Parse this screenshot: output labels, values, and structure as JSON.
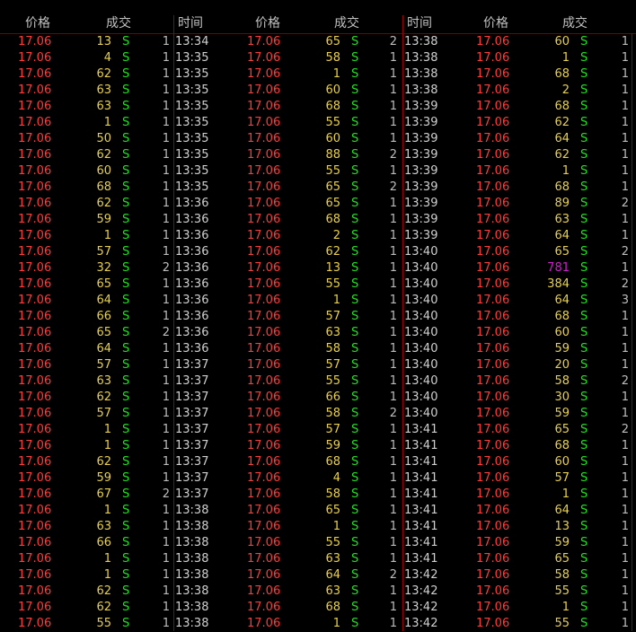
{
  "headers": {
    "panel1": [
      "价格",
      "成交"
    ],
    "panel2": [
      "时间",
      "价格",
      "成交"
    ],
    "panel3": [
      "时间",
      "价格",
      "成交"
    ]
  },
  "panels": [
    {
      "rows": [
        {
          "time": "",
          "price": "17.06",
          "volume": "13",
          "side": "S",
          "count": "1"
        },
        {
          "time": "",
          "price": "17.06",
          "volume": "4",
          "side": "S",
          "count": "1"
        },
        {
          "time": "",
          "price": "17.06",
          "volume": "62",
          "side": "S",
          "count": "1"
        },
        {
          "time": "",
          "price": "17.06",
          "volume": "63",
          "side": "S",
          "count": "1"
        },
        {
          "time": "",
          "price": "17.06",
          "volume": "63",
          "side": "S",
          "count": "1"
        },
        {
          "time": "",
          "price": "17.06",
          "volume": "1",
          "side": "S",
          "count": "1"
        },
        {
          "time": "",
          "price": "17.06",
          "volume": "50",
          "side": "S",
          "count": "1"
        },
        {
          "time": "",
          "price": "17.06",
          "volume": "62",
          "side": "S",
          "count": "1"
        },
        {
          "time": "",
          "price": "17.06",
          "volume": "60",
          "side": "S",
          "count": "1"
        },
        {
          "time": "",
          "price": "17.06",
          "volume": "68",
          "side": "S",
          "count": "1"
        },
        {
          "time": "",
          "price": "17.06",
          "volume": "62",
          "side": "S",
          "count": "1"
        },
        {
          "time": "",
          "price": "17.06",
          "volume": "59",
          "side": "S",
          "count": "1"
        },
        {
          "time": "",
          "price": "17.06",
          "volume": "1",
          "side": "S",
          "count": "1"
        },
        {
          "time": "",
          "price": "17.06",
          "volume": "57",
          "side": "S",
          "count": "1"
        },
        {
          "time": "",
          "price": "17.06",
          "volume": "32",
          "side": "S",
          "count": "2"
        },
        {
          "time": "",
          "price": "17.06",
          "volume": "65",
          "side": "S",
          "count": "1"
        },
        {
          "time": "",
          "price": "17.06",
          "volume": "64",
          "side": "S",
          "count": "1"
        },
        {
          "time": "",
          "price": "17.06",
          "volume": "66",
          "side": "S",
          "count": "1"
        },
        {
          "time": "",
          "price": "17.06",
          "volume": "65",
          "side": "S",
          "count": "2"
        },
        {
          "time": "",
          "price": "17.06",
          "volume": "64",
          "side": "S",
          "count": "1"
        },
        {
          "time": "",
          "price": "17.06",
          "volume": "57",
          "side": "S",
          "count": "1"
        },
        {
          "time": "",
          "price": "17.06",
          "volume": "63",
          "side": "S",
          "count": "1"
        },
        {
          "time": "",
          "price": "17.06",
          "volume": "62",
          "side": "S",
          "count": "1"
        },
        {
          "time": "",
          "price": "17.06",
          "volume": "57",
          "side": "S",
          "count": "1"
        },
        {
          "time": "",
          "price": "17.06",
          "volume": "1",
          "side": "S",
          "count": "1"
        },
        {
          "time": "",
          "price": "17.06",
          "volume": "1",
          "side": "S",
          "count": "1"
        },
        {
          "time": "",
          "price": "17.06",
          "volume": "62",
          "side": "S",
          "count": "1"
        },
        {
          "time": "",
          "price": "17.06",
          "volume": "59",
          "side": "S",
          "count": "1"
        },
        {
          "time": "",
          "price": "17.06",
          "volume": "67",
          "side": "S",
          "count": "2"
        },
        {
          "time": "",
          "price": "17.06",
          "volume": "1",
          "side": "S",
          "count": "1"
        },
        {
          "time": "",
          "price": "17.06",
          "volume": "63",
          "side": "S",
          "count": "1"
        },
        {
          "time": "",
          "price": "17.06",
          "volume": "66",
          "side": "S",
          "count": "1"
        },
        {
          "time": "",
          "price": "17.06",
          "volume": "1",
          "side": "S",
          "count": "1"
        },
        {
          "time": "",
          "price": "17.06",
          "volume": "1",
          "side": "S",
          "count": "1"
        },
        {
          "time": "",
          "price": "17.06",
          "volume": "62",
          "side": "S",
          "count": "1"
        },
        {
          "time": "",
          "price": "17.06",
          "volume": "62",
          "side": "S",
          "count": "1"
        },
        {
          "time": "",
          "price": "17.06",
          "volume": "55",
          "side": "S",
          "count": "1"
        }
      ]
    },
    {
      "rows": [
        {
          "time": "13:34",
          "price": "17.06",
          "volume": "65",
          "side": "S",
          "count": "2"
        },
        {
          "time": "13:35",
          "price": "17.06",
          "volume": "58",
          "side": "S",
          "count": "1"
        },
        {
          "time": "13:35",
          "price": "17.06",
          "volume": "1",
          "side": "S",
          "count": "1"
        },
        {
          "time": "13:35",
          "price": "17.06",
          "volume": "60",
          "side": "S",
          "count": "1"
        },
        {
          "time": "13:35",
          "price": "17.06",
          "volume": "68",
          "side": "S",
          "count": "1"
        },
        {
          "time": "13:35",
          "price": "17.06",
          "volume": "55",
          "side": "S",
          "count": "1"
        },
        {
          "time": "13:35",
          "price": "17.06",
          "volume": "60",
          "side": "S",
          "count": "1"
        },
        {
          "time": "13:35",
          "price": "17.06",
          "volume": "88",
          "side": "S",
          "count": "2"
        },
        {
          "time": "13:35",
          "price": "17.06",
          "volume": "55",
          "side": "S",
          "count": "1"
        },
        {
          "time": "13:35",
          "price": "17.06",
          "volume": "65",
          "side": "S",
          "count": "2"
        },
        {
          "time": "13:36",
          "price": "17.06",
          "volume": "65",
          "side": "S",
          "count": "1"
        },
        {
          "time": "13:36",
          "price": "17.06",
          "volume": "68",
          "side": "S",
          "count": "1"
        },
        {
          "time": "13:36",
          "price": "17.06",
          "volume": "2",
          "side": "S",
          "count": "1"
        },
        {
          "time": "13:36",
          "price": "17.06",
          "volume": "62",
          "side": "S",
          "count": "1"
        },
        {
          "time": "13:36",
          "price": "17.06",
          "volume": "13",
          "side": "S",
          "count": "1"
        },
        {
          "time": "13:36",
          "price": "17.06",
          "volume": "55",
          "side": "S",
          "count": "1"
        },
        {
          "time": "13:36",
          "price": "17.06",
          "volume": "1",
          "side": "S",
          "count": "1"
        },
        {
          "time": "13:36",
          "price": "17.06",
          "volume": "57",
          "side": "S",
          "count": "1"
        },
        {
          "time": "13:36",
          "price": "17.06",
          "volume": "63",
          "side": "S",
          "count": "1"
        },
        {
          "time": "13:36",
          "price": "17.06",
          "volume": "58",
          "side": "S",
          "count": "1"
        },
        {
          "time": "13:37",
          "price": "17.06",
          "volume": "57",
          "side": "S",
          "count": "1"
        },
        {
          "time": "13:37",
          "price": "17.06",
          "volume": "55",
          "side": "S",
          "count": "1"
        },
        {
          "time": "13:37",
          "price": "17.06",
          "volume": "66",
          "side": "S",
          "count": "1"
        },
        {
          "time": "13:37",
          "price": "17.06",
          "volume": "58",
          "side": "S",
          "count": "2"
        },
        {
          "time": "13:37",
          "price": "17.06",
          "volume": "57",
          "side": "S",
          "count": "1"
        },
        {
          "time": "13:37",
          "price": "17.06",
          "volume": "59",
          "side": "S",
          "count": "1"
        },
        {
          "time": "13:37",
          "price": "17.06",
          "volume": "68",
          "side": "S",
          "count": "1"
        },
        {
          "time": "13:37",
          "price": "17.06",
          "volume": "4",
          "side": "S",
          "count": "1"
        },
        {
          "time": "13:37",
          "price": "17.06",
          "volume": "58",
          "side": "S",
          "count": "1"
        },
        {
          "time": "13:38",
          "price": "17.06",
          "volume": "65",
          "side": "S",
          "count": "1"
        },
        {
          "time": "13:38",
          "price": "17.06",
          "volume": "1",
          "side": "S",
          "count": "1"
        },
        {
          "time": "13:38",
          "price": "17.06",
          "volume": "55",
          "side": "S",
          "count": "1"
        },
        {
          "time": "13:38",
          "price": "17.06",
          "volume": "63",
          "side": "S",
          "count": "1"
        },
        {
          "time": "13:38",
          "price": "17.06",
          "volume": "64",
          "side": "S",
          "count": "2"
        },
        {
          "time": "13:38",
          "price": "17.06",
          "volume": "63",
          "side": "S",
          "count": "1"
        },
        {
          "time": "13:38",
          "price": "17.06",
          "volume": "68",
          "side": "S",
          "count": "1"
        },
        {
          "time": "13:38",
          "price": "17.06",
          "volume": "1",
          "side": "S",
          "count": "1"
        }
      ]
    },
    {
      "rows": [
        {
          "time": "13:38",
          "price": "17.06",
          "volume": "60",
          "side": "S",
          "count": "1"
        },
        {
          "time": "13:38",
          "price": "17.06",
          "volume": "1",
          "side": "S",
          "count": "1"
        },
        {
          "time": "13:38",
          "price": "17.06",
          "volume": "68",
          "side": "S",
          "count": "1"
        },
        {
          "time": "13:38",
          "price": "17.06",
          "volume": "2",
          "side": "S",
          "count": "1"
        },
        {
          "time": "13:39",
          "price": "17.06",
          "volume": "68",
          "side": "S",
          "count": "1"
        },
        {
          "time": "13:39",
          "price": "17.06",
          "volume": "62",
          "side": "S",
          "count": "1"
        },
        {
          "time": "13:39",
          "price": "17.06",
          "volume": "64",
          "side": "S",
          "count": "1"
        },
        {
          "time": "13:39",
          "price": "17.06",
          "volume": "62",
          "side": "S",
          "count": "1"
        },
        {
          "time": "13:39",
          "price": "17.06",
          "volume": "1",
          "side": "S",
          "count": "1"
        },
        {
          "time": "13:39",
          "price": "17.06",
          "volume": "68",
          "side": "S",
          "count": "1"
        },
        {
          "time": "13:39",
          "price": "17.06",
          "volume": "89",
          "side": "S",
          "count": "2"
        },
        {
          "time": "13:39",
          "price": "17.06",
          "volume": "63",
          "side": "S",
          "count": "1"
        },
        {
          "time": "13:39",
          "price": "17.06",
          "volume": "64",
          "side": "S",
          "count": "1"
        },
        {
          "time": "13:40",
          "price": "17.06",
          "volume": "65",
          "side": "S",
          "count": "2"
        },
        {
          "time": "13:40",
          "price": "17.06",
          "volume": "781",
          "side": "S",
          "count": "1",
          "highlight": true
        },
        {
          "time": "13:40",
          "price": "17.06",
          "volume": "384",
          "side": "S",
          "count": "2"
        },
        {
          "time": "13:40",
          "price": "17.06",
          "volume": "64",
          "side": "S",
          "count": "3"
        },
        {
          "time": "13:40",
          "price": "17.06",
          "volume": "68",
          "side": "S",
          "count": "1"
        },
        {
          "time": "13:40",
          "price": "17.06",
          "volume": "60",
          "side": "S",
          "count": "1"
        },
        {
          "time": "13:40",
          "price": "17.06",
          "volume": "59",
          "side": "S",
          "count": "1"
        },
        {
          "time": "13:40",
          "price": "17.06",
          "volume": "20",
          "side": "S",
          "count": "1"
        },
        {
          "time": "13:40",
          "price": "17.06",
          "volume": "58",
          "side": "S",
          "count": "2"
        },
        {
          "time": "13:40",
          "price": "17.06",
          "volume": "30",
          "side": "S",
          "count": "1"
        },
        {
          "time": "13:40",
          "price": "17.06",
          "volume": "59",
          "side": "S",
          "count": "1"
        },
        {
          "time": "13:41",
          "price": "17.06",
          "volume": "65",
          "side": "S",
          "count": "2"
        },
        {
          "time": "13:41",
          "price": "17.06",
          "volume": "68",
          "side": "S",
          "count": "1"
        },
        {
          "time": "13:41",
          "price": "17.06",
          "volume": "60",
          "side": "S",
          "count": "1"
        },
        {
          "time": "13:41",
          "price": "17.06",
          "volume": "57",
          "side": "S",
          "count": "1"
        },
        {
          "time": "13:41",
          "price": "17.06",
          "volume": "1",
          "side": "S",
          "count": "1"
        },
        {
          "time": "13:41",
          "price": "17.06",
          "volume": "64",
          "side": "S",
          "count": "1"
        },
        {
          "time": "13:41",
          "price": "17.06",
          "volume": "13",
          "side": "S",
          "count": "1"
        },
        {
          "time": "13:41",
          "price": "17.06",
          "volume": "59",
          "side": "S",
          "count": "1"
        },
        {
          "time": "13:41",
          "price": "17.06",
          "volume": "65",
          "side": "S",
          "count": "1"
        },
        {
          "time": "13:42",
          "price": "17.06",
          "volume": "58",
          "side": "S",
          "count": "1"
        },
        {
          "time": "13:42",
          "price": "17.06",
          "volume": "55",
          "side": "S",
          "count": "1"
        },
        {
          "time": "13:42",
          "price": "17.06",
          "volume": "1",
          "side": "S",
          "count": "1"
        },
        {
          "time": "13:42",
          "price": "17.06",
          "volume": "55",
          "side": "S",
          "count": "1"
        }
      ]
    }
  ],
  "colors": {
    "background": "#000000",
    "price": "#ff3b3b",
    "volume": "#e8d04c",
    "volume_large": "#d020d0",
    "sell": "#20e020",
    "time": "#d0d0d0",
    "grid": "#9a0000"
  }
}
